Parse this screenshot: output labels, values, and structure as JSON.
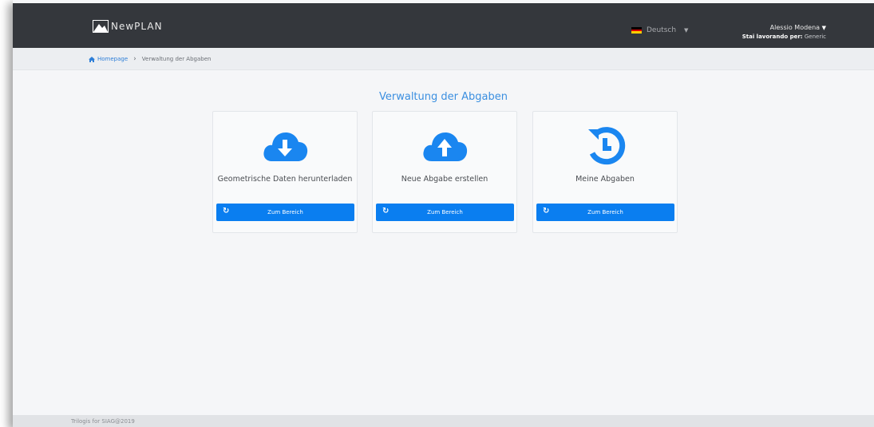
{
  "header": {
    "brand": "NewPLAN",
    "language": "Deutsch",
    "user_name": "Alessio Modena",
    "working_for_label": "Stai lavorando per:",
    "working_for_value": "Generic"
  },
  "breadcrumb": {
    "home": "Homepage",
    "current": "Verwaltung der Abgaben"
  },
  "main": {
    "title": "Verwaltung der Abgaben",
    "cards": [
      {
        "title": "Geometrische Daten herunterladen",
        "button": "Zum Bereich",
        "icon": "cloud-download-icon"
      },
      {
        "title": "Neue Abgabe erstellen",
        "button": "Zum Bereich",
        "icon": "cloud-upload-icon"
      },
      {
        "title": "Meine Abgaben",
        "button": "Zum Bereich",
        "icon": "history-icon"
      }
    ]
  },
  "footer": {
    "text": "Trilogis for SIAG@2019"
  },
  "colors": {
    "navbar": "#34373c",
    "accent": "#0a7ef0",
    "title": "#3b8fe0",
    "icon": "#1a86f0"
  }
}
